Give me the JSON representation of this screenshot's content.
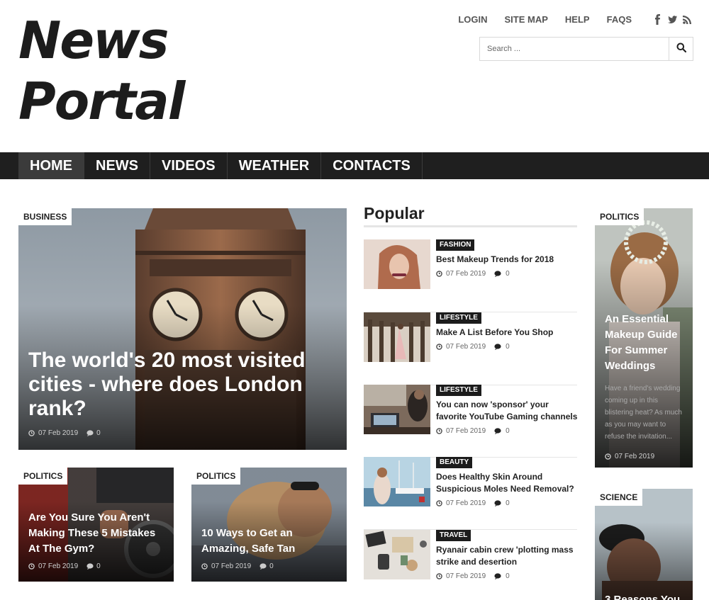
{
  "header": {
    "logo_line1": "News",
    "logo_line2": "Portal",
    "links": [
      "LOGIN",
      "SITE MAP",
      "HELP",
      "FAQS"
    ],
    "social": [
      "facebook-icon",
      "twitter-icon",
      "rss-icon"
    ],
    "search_placeholder": "Search ..."
  },
  "nav": {
    "items": [
      "HOME",
      "NEWS",
      "VIDEOS",
      "WEATHER",
      "CONTACTS"
    ],
    "active": "HOME"
  },
  "featured": {
    "category": "BUSINESS",
    "title": "The world's 20 most visited cities - where does London rank?",
    "date": "07 Feb 2019",
    "comments": "0"
  },
  "small_cards": [
    {
      "category": "POLITICS",
      "title": "Are You Sure You Aren't Making These 5 Mistakes At The Gym?",
      "date": "07 Feb 2019",
      "comments": "0"
    },
    {
      "category": "POLITICS",
      "title": "10 Ways to Get an Amazing, Safe Tan",
      "date": "07 Feb 2019",
      "comments": "0"
    }
  ],
  "popular": {
    "heading": "Popular",
    "items": [
      {
        "category": "FASHION",
        "title": "Best Makeup Trends for 2018",
        "date": "07 Feb 2019",
        "comments": "0"
      },
      {
        "category": "LIFESTYLE",
        "title": "Make A List Before You Shop",
        "date": "07 Feb 2019",
        "comments": "0"
      },
      {
        "category": "LIFESTYLE",
        "title": "You can now 'sponsor' your favorite YouTube Gaming channels",
        "date": "07 Feb 2019",
        "comments": "0"
      },
      {
        "category": "BEAUTY",
        "title": "Does Healthy Skin Around Suspicious Moles Need Removal?",
        "date": "07 Feb 2019",
        "comments": "0"
      },
      {
        "category": "TRAVEL",
        "title": "Ryanair cabin crew 'plotting mass strike and desertion",
        "date": "07 Feb 2019",
        "comments": "0"
      }
    ]
  },
  "side_cards": [
    {
      "category": "POLITICS",
      "title": "An Essential Makeup Guide For Summer Weddings",
      "excerpt": "Have a friend's wedding coming up in this blistering heat? As much as you may want to refuse the invitation...",
      "date": "07 Feb 2019"
    },
    {
      "category": "SCIENCE",
      "title": "3 Reasons You"
    }
  ],
  "colors": {
    "nav_bg": "#1f1f1f",
    "nav_active": "#3b3b3b",
    "tag_dark": "#1c1c1c",
    "text": "#222222"
  }
}
